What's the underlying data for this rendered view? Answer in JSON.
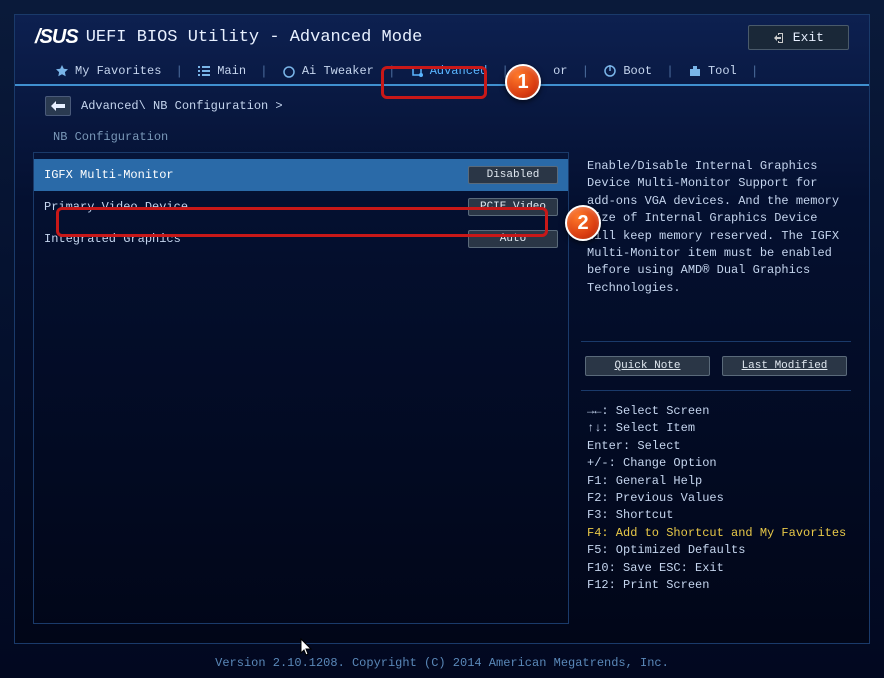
{
  "header": {
    "logo": "/SUS",
    "title": "UEFI BIOS Utility - Advanced Mode",
    "exit_label": "Exit"
  },
  "tabs": {
    "favorites": "My Favorites",
    "main": "Main",
    "ai_tweaker": "Ai Tweaker",
    "advanced": "Advanced",
    "monitor_suffix": "or",
    "boot": "Boot",
    "tool": "Tool"
  },
  "breadcrumb": "Advanced\\ NB Configuration >",
  "section": "NB Configuration",
  "settings": [
    {
      "label": "IGFX Multi-Monitor",
      "value": "Disabled"
    },
    {
      "label": "Primary Video Device",
      "value": "PCIE Video"
    },
    {
      "label": "Integrated Graphics",
      "value": "Auto"
    }
  ],
  "help_text": "Enable/Disable Internal Graphics Device Multi-Monitor Support for add-ons VGA devices.\nAnd the memory size of Internal Graphics Device will keep memory reserved.\nThe IGFX Multi-Monitor item must be enabled before using AMD® Dual Graphics Technologies.",
  "sidebar_buttons": {
    "quick_note": "Quick Note",
    "last_modified": "Last Modified"
  },
  "hotkeys": {
    "l1": "→←: Select Screen",
    "l2": "↑↓: Select Item",
    "l3": "Enter: Select",
    "l4": "+/-: Change Option",
    "l5": "F1: General Help",
    "l6": "F2: Previous Values",
    "l7": "F3: Shortcut",
    "l8": "F4: Add to Shortcut and My Favorites",
    "l9": "F5: Optimized Defaults",
    "l10": "F10: Save  ESC: Exit",
    "l11": "F12: Print Screen"
  },
  "footer": "Version 2.10.1208. Copyright (C) 2014 American Megatrends, Inc.",
  "callouts": {
    "one": "1",
    "two": "2"
  }
}
